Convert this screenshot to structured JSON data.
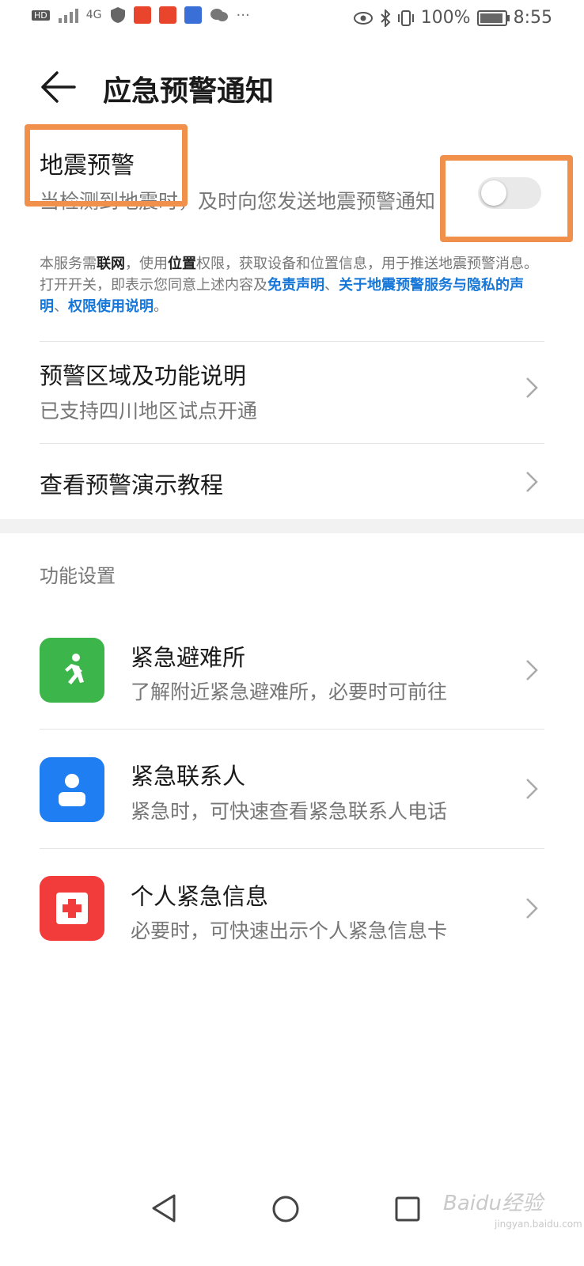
{
  "status_bar": {
    "battery": "100%",
    "time": "8:55",
    "net": "4G",
    "hd": "HD"
  },
  "header": {
    "title": "应急预警通知"
  },
  "earthquake": {
    "title": "地震预警",
    "description": "当检测到地震时，及时向您发送地震预警通知",
    "toggle_on": false,
    "notice": {
      "p1": "本服务需",
      "b1": "联网",
      "p2": "，使用",
      "b2": "位置",
      "p3": "权限，获取设备和位置信息，用于推送地震预警消息。打开开关，即表示您同意上述内容及",
      "l1": "免责声明",
      "p4": "、",
      "l2": "关于地震预警服务与隐私的声明",
      "p5": "、",
      "l3": "权限使用说明",
      "p6": "。"
    }
  },
  "rows": {
    "region_title": "预警区域及功能说明",
    "region_sub": "已支持四川地区试点开通",
    "tutorial_title": "查看预警演示教程"
  },
  "section_title": "功能设置",
  "features": {
    "shelter_title": "紧急避难所",
    "shelter_sub": "了解附近紧急避难所，必要时可前往",
    "contact_title": "紧急联系人",
    "contact_sub": "紧急时，可快速查看紧急联系人电话",
    "info_title": "个人紧急信息",
    "info_sub": "必要时，可快速出示个人紧急信息卡"
  },
  "colors": {
    "highlight": "#f0904a",
    "shelter": "#3cb54a",
    "contact": "#1e7ef2",
    "info": "#f23b3b",
    "link": "#1677d8"
  },
  "watermark": {
    "text": "Baidu经验",
    "sub": "jingyan.baidu.com"
  }
}
